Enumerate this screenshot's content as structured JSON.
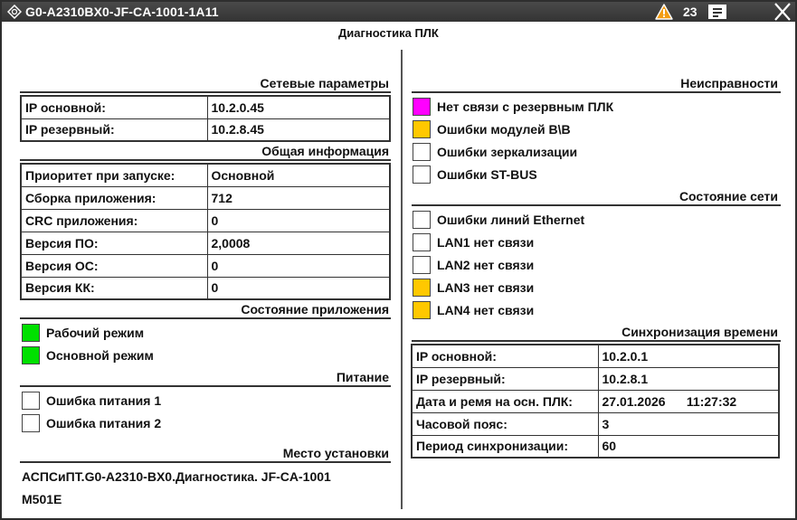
{
  "window": {
    "title": "G0-A2310BX0-JF-CA-1001-1A11",
    "alarm_count": "23"
  },
  "page_title": "Диагностика ПЛК",
  "network": {
    "title": "Сетевые параметры",
    "rows": [
      {
        "label": "IP основной:",
        "value": "10.2.0.45"
      },
      {
        "label": "IP резервный:",
        "value": "10.2.8.45"
      }
    ]
  },
  "general": {
    "title": "Общая информация",
    "rows": [
      {
        "label": "Приоритет при запуске:",
        "value": "Основной"
      },
      {
        "label": "Сборка приложения:",
        "value": "712"
      },
      {
        "label": "CRC приложения:",
        "value": "0"
      },
      {
        "label": "Версия ПО:",
        "value": "2,0008"
      },
      {
        "label": "Версия ОС:",
        "value": "0"
      },
      {
        "label": "Версия КК:",
        "value": "0"
      }
    ]
  },
  "app_state": {
    "title": "Состояние приложения",
    "items": [
      {
        "label": "Рабочий режим",
        "color": "#00e000"
      },
      {
        "label": "Основной режим",
        "color": "#00e000"
      }
    ]
  },
  "power": {
    "title": "Питание",
    "items": [
      {
        "label": "Ошибка питания 1",
        "color": "#ffffff"
      },
      {
        "label": "Ошибка питания 2",
        "color": "#ffffff"
      }
    ]
  },
  "install": {
    "title": "Место установки",
    "line1": "АСПСиПТ.G0-A2310-BX0.Диагностика. JF-CA-1001",
    "line2": "M501E"
  },
  "faults": {
    "title": "Неисправности",
    "items": [
      {
        "label": "Нет связи с резервным ПЛК",
        "color": "#ff00ff"
      },
      {
        "label": "Ошибки модулей В\\В",
        "color": "#ffc800"
      },
      {
        "label": "Ошибки зеркализации",
        "color": "#ffffff"
      },
      {
        "label": "Ошибки ST-BUS",
        "color": "#ffffff"
      }
    ]
  },
  "net_state": {
    "title": "Состояние сети",
    "items": [
      {
        "label": "Ошибки линий Ethernet",
        "color": "#ffffff"
      },
      {
        "label": "LAN1 нет связи",
        "color": "#ffffff"
      },
      {
        "label": "LAN2 нет связи",
        "color": "#ffffff"
      },
      {
        "label": "LAN3 нет связи",
        "color": "#ffc800"
      },
      {
        "label": "LAN4 нет связи",
        "color": "#ffc800"
      }
    ]
  },
  "time_sync": {
    "title": "Синхронизация времени",
    "rows": [
      {
        "label": "IP основной:",
        "value": "10.2.0.1"
      },
      {
        "label": "IP резервный:",
        "value": "10.2.8.1"
      },
      {
        "label": "Дата и ремя на осн. ПЛК:",
        "value": "27.01.2026      11:27:32"
      },
      {
        "label": "Часовой пояс:",
        "value": "3"
      },
      {
        "label": "Период синхронизации:",
        "value": "60"
      }
    ]
  }
}
